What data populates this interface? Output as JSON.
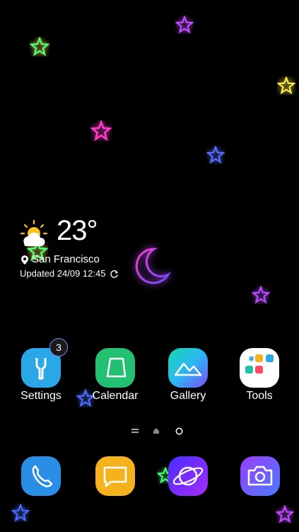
{
  "weather": {
    "temperature": "23°",
    "location": "San Francisco",
    "updated": "Updated 24/09 12:45",
    "condition_icon": "partly-cloudy-icon"
  },
  "apps": [
    {
      "label": "Settings",
      "icon": "settings-icon",
      "badge": "3"
    },
    {
      "label": "Calendar",
      "icon": "calendar-icon"
    },
    {
      "label": "Gallery",
      "icon": "gallery-icon"
    },
    {
      "label": "Tools",
      "icon": "folder-icon"
    }
  ],
  "dock": [
    {
      "icon": "phone-icon"
    },
    {
      "icon": "messages-icon"
    },
    {
      "icon": "internet-icon"
    },
    {
      "icon": "camera-icon"
    }
  ],
  "page_indicator": {
    "pages": [
      "menu-lines-icon",
      "home-icon",
      "page-dot-icon"
    ],
    "current": 1
  },
  "colors": {
    "settings": "#2aa7e6",
    "calendar": "#23c072",
    "gallery_from": "#18c9c9",
    "gallery_to": "#7b4dff",
    "tools": "#ffffff",
    "phone": "#2a8de6",
    "messages": "#f5b21f",
    "internet_from": "#6a2cff",
    "internet_to": "#a42cff",
    "camera_from": "#7a40ff",
    "camera_to": "#4a7bff"
  }
}
